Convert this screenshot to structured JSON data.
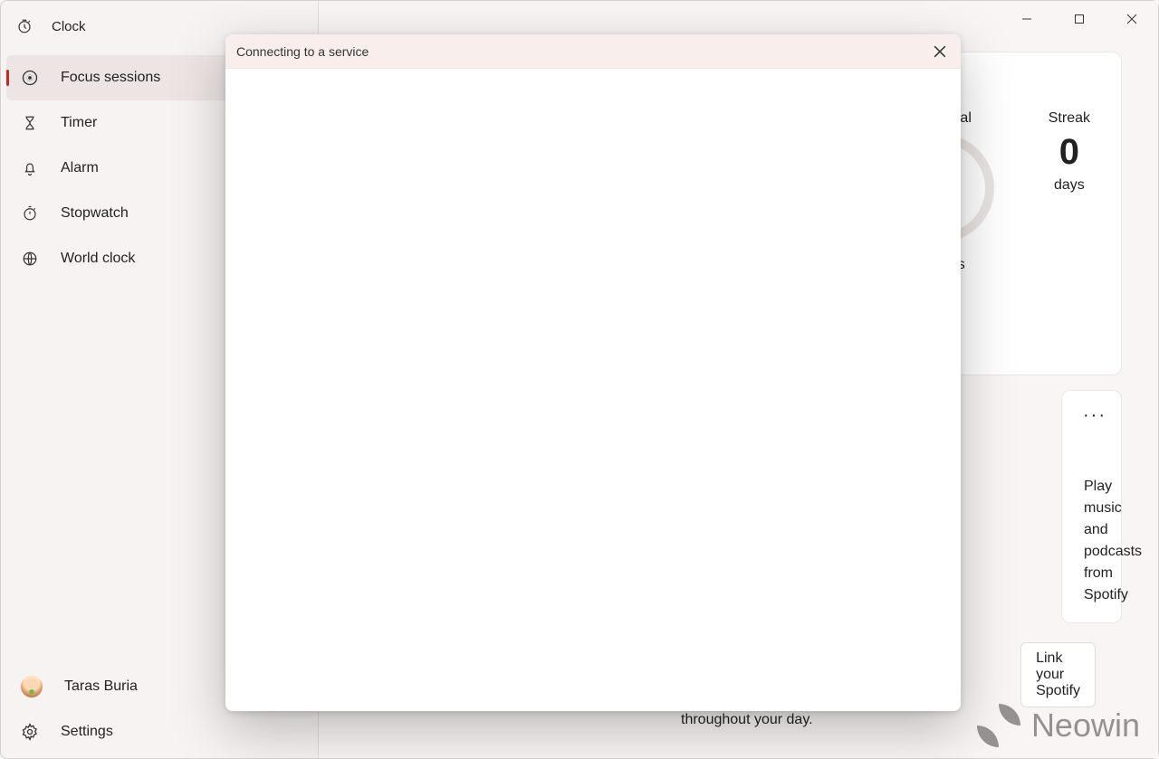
{
  "app_title": "Clock",
  "sidebar": {
    "items": [
      {
        "label": "Focus sessions",
        "selected": true,
        "icon": "focus-icon"
      },
      {
        "label": "Timer",
        "selected": false,
        "icon": "hourglass-icon"
      },
      {
        "label": "Alarm",
        "selected": false,
        "icon": "bell-icon"
      },
      {
        "label": "Stopwatch",
        "selected": false,
        "icon": "stopwatch-icon"
      },
      {
        "label": "World clock",
        "selected": false,
        "icon": "globe-icon"
      }
    ]
  },
  "user": {
    "name": "Taras Buria"
  },
  "settings_label": "Settings",
  "progress": {
    "daily_label": "Daily goal",
    "daily_unit": "minutes",
    "streak_label": "Streak",
    "streak_value": "0",
    "streak_unit": "days"
  },
  "spotify": {
    "text": "Play music and podcasts from Spotify",
    "link_label": "Link your Spotify"
  },
  "hint": "throughout your day.",
  "modal": {
    "title": "Connecting to a service"
  },
  "watermark": "Neowin"
}
